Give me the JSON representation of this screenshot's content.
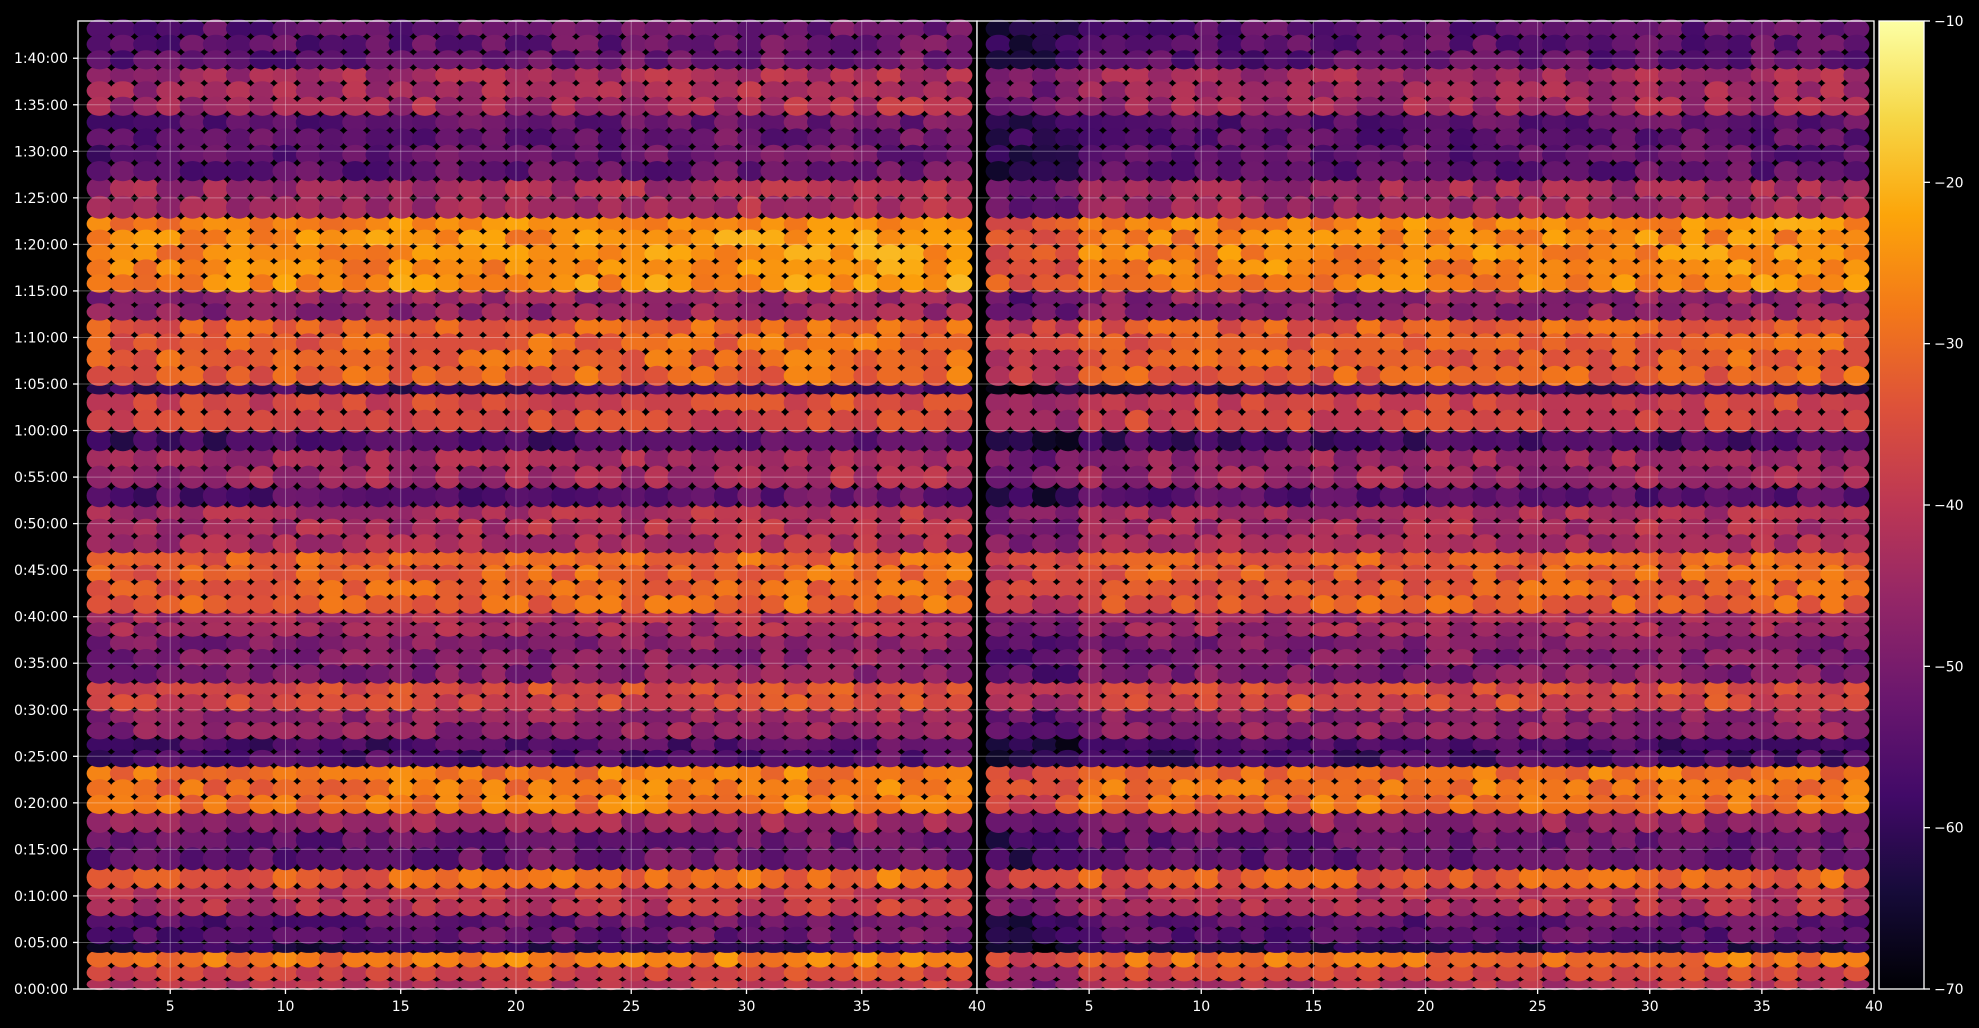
{
  "chart_data": {
    "type": "heatmap",
    "title": "",
    "xlabel": "",
    "ylabel": "",
    "panels": [
      {
        "name": "",
        "xlim": [
          1,
          40
        ]
      },
      {
        "name": "",
        "xlim": [
          0,
          40
        ]
      }
    ],
    "x_ticks": [
      5,
      10,
      15,
      20,
      25,
      30,
      35,
      40
    ],
    "x_tick_labels": [
      "5",
      "10",
      "15",
      "20",
      "25",
      "30",
      "35",
      "40"
    ],
    "ylim_seconds": [
      0,
      6240
    ],
    "y_ticks_seconds": [
      0,
      300,
      600,
      900,
      1200,
      1500,
      1800,
      2100,
      2400,
      2700,
      3000,
      3300,
      3600,
      3900,
      4200,
      4500,
      4800,
      5100,
      5400,
      5700,
      6000
    ],
    "y_tick_labels": [
      "0:00:00",
      "0:05:00",
      "0:10:00",
      "0:15:00",
      "0:20:00",
      "0:25:00",
      "0:30:00",
      "0:35:00",
      "0:40:00",
      "0:45:00",
      "0:50:00",
      "0:55:00",
      "1:00:00",
      "1:05:00",
      "1:10:00",
      "1:15:00",
      "1:20:00",
      "1:25:00",
      "1:30:00",
      "1:35:00",
      "1:40:00"
    ],
    "grid": true,
    "colorbar": {
      "colormap": "inferno",
      "range": [
        -70,
        -10
      ],
      "ticks": [
        -10,
        -20,
        -30,
        -40,
        -50,
        -60,
        -70
      ],
      "tick_labels": [
        "−10",
        "−20",
        "−30",
        "−40",
        "−50",
        "−60",
        "−70"
      ],
      "placement": "right"
    },
    "bands": [
      {
        "t_start": "0:00:00",
        "t_end": "0:01:00",
        "level": -43
      },
      {
        "t_start": "0:01:00",
        "t_end": "0:02:30",
        "level": -38
      },
      {
        "t_start": "0:02:30",
        "t_end": "0:04:00",
        "level": -30
      },
      {
        "t_start": "0:04:00",
        "t_end": "0:05:00",
        "level": -62
      },
      {
        "t_start": "0:05:00",
        "t_end": "0:08:00",
        "level": -55
      },
      {
        "t_start": "0:08:00",
        "t_end": "0:11:00",
        "level": -42
      },
      {
        "t_start": "0:11:00",
        "t_end": "0:13:00",
        "level": -33
      },
      {
        "t_start": "0:13:00",
        "t_end": "0:17:00",
        "level": -54
      },
      {
        "t_start": "0:17:00",
        "t_end": "0:19:00",
        "level": -47
      },
      {
        "t_start": "0:19:00",
        "t_end": "0:24:00",
        "level": -30
      },
      {
        "t_start": "0:24:00",
        "t_end": "0:27:00",
        "level": -58
      },
      {
        "t_start": "0:27:00",
        "t_end": "0:30:00",
        "level": -48
      },
      {
        "t_start": "0:30:00",
        "t_end": "0:33:00",
        "level": -37
      },
      {
        "t_start": "0:33:00",
        "t_end": "0:38:00",
        "level": -50
      },
      {
        "t_start": "0:38:00",
        "t_end": "0:40:30",
        "level": -45
      },
      {
        "t_start": "0:40:30",
        "t_end": "0:47:00",
        "level": -33
      },
      {
        "t_start": "0:47:00",
        "t_end": "0:52:00",
        "level": -44
      },
      {
        "t_start": "0:52:00",
        "t_end": "0:54:00",
        "level": -56
      },
      {
        "t_start": "0:54:00",
        "t_end": "0:58:00",
        "level": -46
      },
      {
        "t_start": "0:58:00",
        "t_end": "1:00:00",
        "level": -58
      },
      {
        "t_start": "1:00:00",
        "t_end": "1:04:00",
        "level": -38
      },
      {
        "t_start": "1:04:00",
        "t_end": "1:05:00",
        "level": -60
      },
      {
        "t_start": "1:05:00",
        "t_end": "1:12:00",
        "level": -33
      },
      {
        "t_start": "1:12:00",
        "t_end": "1:15:00",
        "level": -48
      },
      {
        "t_start": "1:15:00",
        "t_end": "1:23:00",
        "level": -27
      },
      {
        "t_start": "1:23:00",
        "t_end": "1:27:00",
        "level": -45
      },
      {
        "t_start": "1:27:00",
        "t_end": "1:34:00",
        "level": -55
      },
      {
        "t_start": "1:34:00",
        "t_end": "1:39:00",
        "level": -45
      },
      {
        "t_start": "1:39:00",
        "t_end": "1:44:00",
        "level": -55
      }
    ]
  }
}
